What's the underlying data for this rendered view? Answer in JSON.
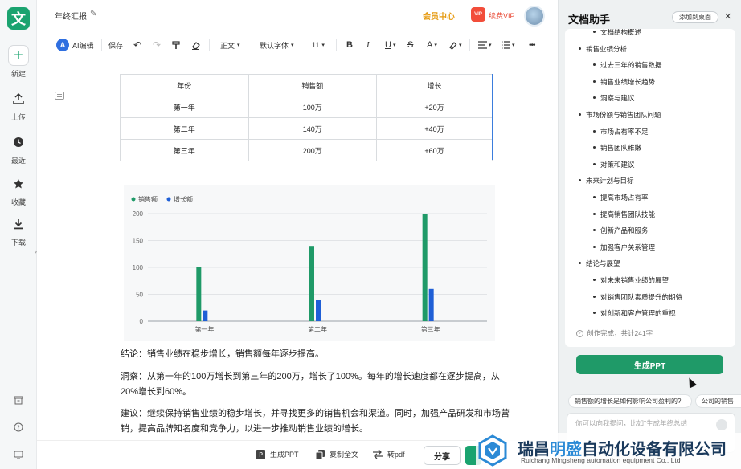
{
  "app": {
    "logo_char": "文"
  },
  "rail": {
    "items": [
      {
        "label": "新建"
      },
      {
        "label": "上传"
      },
      {
        "label": "最近"
      },
      {
        "label": "收藏"
      },
      {
        "label": "下载"
      }
    ]
  },
  "header": {
    "doc_title": "年终汇报",
    "member_center": "会员中心",
    "vip_badge": "VIP",
    "renew_vip": "续费VIP"
  },
  "toolbar": {
    "ai_edit": "AI编辑",
    "save": "保存",
    "paragraph_style": "正文",
    "font_family": "默认字体",
    "font_size": "11",
    "bold": "B",
    "italic": "I",
    "underline": "U",
    "strike": "S",
    "font_color": "A",
    "more": "•••"
  },
  "table": {
    "headers": [
      "年份",
      "销售额",
      "增长"
    ],
    "rows": [
      [
        "第一年",
        "100万",
        "+20万"
      ],
      [
        "第二年",
        "140万",
        "+40万"
      ],
      [
        "第三年",
        "200万",
        "+60万"
      ]
    ]
  },
  "chart_data": {
    "type": "bar",
    "categories": [
      "第一年",
      "第二年",
      "第三年"
    ],
    "series": [
      {
        "name": "销售额",
        "values": [
          100,
          140,
          200
        ],
        "color": "#1f9a68"
      },
      {
        "name": "增长额",
        "values": [
          20,
          40,
          60
        ],
        "color": "#1f5fd6"
      }
    ],
    "yticks": [
      0,
      50,
      100,
      150,
      200
    ],
    "ylim": [
      0,
      200
    ],
    "legend": "top-left",
    "grid": true
  },
  "paragraphs": {
    "p1": "结论：销售业绩在稳步增长，销售额每年逐步提高。",
    "p2": "洞察：从第一年的100万增长到第三年的200万，增长了100%。每年的增长速度都在逐步提高，从20%增长到60%。",
    "p3": "建议：继续保持销售业绩的稳步增长，并寻找更多的销售机会和渠道。同时，加强产品研发和市场营销，提高品牌知名度和竞争力，以进一步推动销售业绩的增长。"
  },
  "bottombar": {
    "gen_ppt": "生成PPT",
    "copy_all": "复制全文",
    "to_pdf": "转pdf",
    "share": "分享"
  },
  "panel": {
    "title": "文档助手",
    "add_desktop": "添加到桌面",
    "outline": [
      {
        "level": 2,
        "text": "文档结构概述"
      },
      {
        "level": 1,
        "text": "销售业绩分析"
      },
      {
        "level": 2,
        "text": "过去三年的销售数据"
      },
      {
        "level": 2,
        "text": "销售业绩增长趋势"
      },
      {
        "level": 2,
        "text": "洞察与建议"
      },
      {
        "level": 1,
        "text": "市场份额与销售团队问题"
      },
      {
        "level": 2,
        "text": "市场占有率不足"
      },
      {
        "level": 2,
        "text": "销售团队稚嫩"
      },
      {
        "level": 2,
        "text": "对策和建议"
      },
      {
        "level": 1,
        "text": "未来计划与目标"
      },
      {
        "level": 2,
        "text": "提高市场占有率"
      },
      {
        "level": 2,
        "text": "提高销售团队技能"
      },
      {
        "level": 2,
        "text": "创新产品和服务"
      },
      {
        "level": 2,
        "text": "加强客户关系管理"
      },
      {
        "level": 1,
        "text": "结论与展望"
      },
      {
        "level": 2,
        "text": "对未来销售业绩的展望"
      },
      {
        "level": 2,
        "text": "对销售团队素质提升的期待"
      },
      {
        "level": 2,
        "text": "对创新和客户管理的重视"
      }
    ],
    "done_text": "创作完成，共计241字",
    "gen_ppt": "生成PPT",
    "suggestions": [
      "销售额的增长是如何影响公司盈利的?",
      "公司的销售"
    ],
    "ask_placeholder": "你可以向我提问，比如\"生成年终总结"
  },
  "watermark": {
    "cn_a": "瑞昌",
    "cn_hl": "明盛",
    "cn_b": "自动化设备有限公司",
    "en": "Ruichang Mingsheng automation equipment Co., Ltd"
  }
}
